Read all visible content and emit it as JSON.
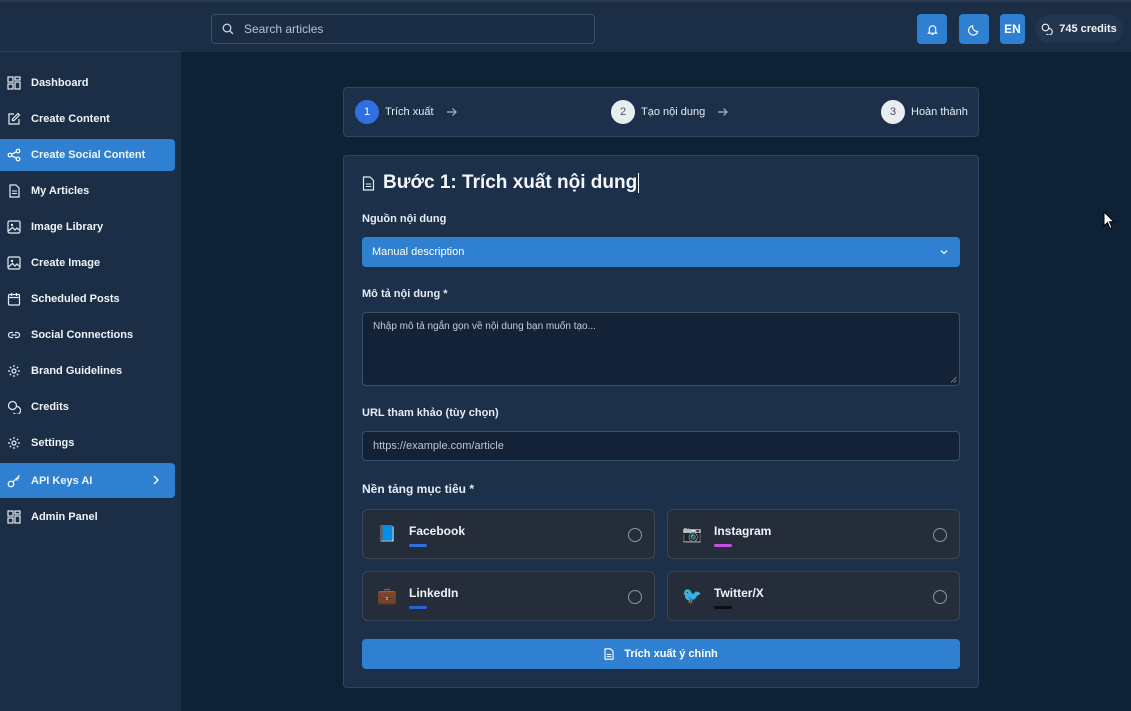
{
  "search": {
    "placeholder": "Search articles"
  },
  "header": {
    "lang_label": "EN",
    "credits_label": "745 credits"
  },
  "sidebar": {
    "items": [
      {
        "label": "Dashboard",
        "icon": "grid-icon"
      },
      {
        "label": "Create Content",
        "icon": "pen-square-icon"
      },
      {
        "label": "Create Social Content",
        "icon": "share-icon",
        "active": true
      },
      {
        "label": "My Articles",
        "icon": "document-icon"
      },
      {
        "label": "Image Library",
        "icon": "image-icon"
      },
      {
        "label": "Create Image",
        "icon": "image-icon"
      },
      {
        "label": "Scheduled Posts",
        "icon": "calendar-icon"
      },
      {
        "label": "Social Connections",
        "icon": "link-icon"
      },
      {
        "label": "Brand Guidelines",
        "icon": "gear-icon"
      },
      {
        "label": "Credits",
        "icon": "coins-icon"
      },
      {
        "label": "Settings",
        "icon": "gear-icon"
      },
      {
        "label": "API Keys AI",
        "icon": "key-icon",
        "active": true
      },
      {
        "label": "Admin Panel",
        "icon": "grid-icon"
      }
    ]
  },
  "stepper": {
    "steps": [
      {
        "num": "1",
        "label": "Trích xuất"
      },
      {
        "num": "2",
        "label": "Tạo nội dung"
      },
      {
        "num": "3",
        "label": "Hoàn thành"
      }
    ]
  },
  "form": {
    "title": "Bước 1: Trích xuất nội dung",
    "source_label": "Nguồn nội dung",
    "source_value": "Manual description",
    "desc_label": "Mô tả nội dung *",
    "desc_placeholder": "Nhập mô tả ngắn gọn về nội dung bạn muốn tạo...",
    "url_label": "URL tham khảo (tùy chọn)",
    "url_placeholder": "https://example.com/article",
    "platforms_label": "Nền tảng mục tiêu *",
    "platforms": [
      {
        "name": "Facebook",
        "icon": "book-emoji-icon",
        "accent": "#2f6fe0"
      },
      {
        "name": "Instagram",
        "icon": "camera-emoji-icon",
        "accent": "#c44fe0"
      },
      {
        "name": "LinkedIn",
        "icon": "briefcase-emoji-icon",
        "accent": "#2f5fd6"
      },
      {
        "name": "Twitter/X",
        "icon": "bird-emoji-icon",
        "accent": "#0b0f16"
      }
    ],
    "submit_label": "Trích xuất ý chính"
  },
  "colors": {
    "accent": "#2f80d0",
    "background": "#0f2135",
    "sidebar": "#1b2e45",
    "card": "#1c3049"
  }
}
